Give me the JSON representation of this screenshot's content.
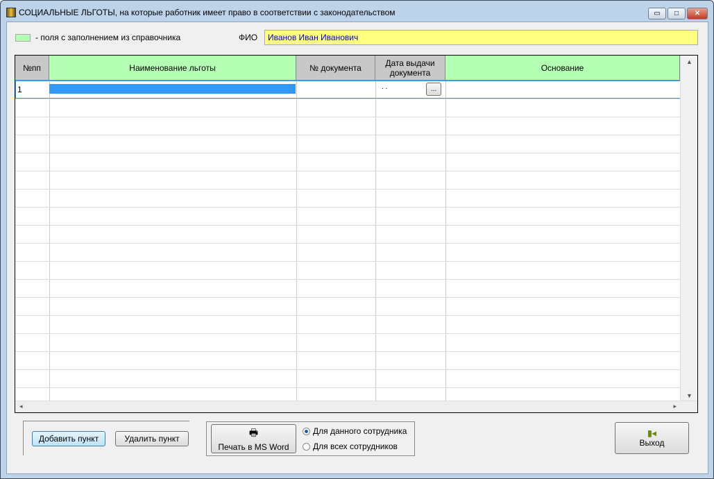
{
  "window": {
    "title": "СОЦИАЛЬНЫЕ ЛЬГОТЫ, на которые работник имеет право в соответствии с законодательством",
    "minimize": "▭",
    "maximize": "□",
    "close": "✕"
  },
  "legend": {
    "text": "- поля с заполнением из справочника",
    "color": "#b4ffb4"
  },
  "fio": {
    "label": "ФИО",
    "value": "Иванов Иван Иванович"
  },
  "table": {
    "columns": [
      "№пп",
      "Наименование льготы",
      "№ документа",
      "Дата выдачи документа",
      "Основание"
    ],
    "rows": [
      {
        "num": "1",
        "name": "",
        "doc": "",
        "date": ". .",
        "basis": ""
      }
    ],
    "date_button": "..."
  },
  "buttons": {
    "add": "Добавить пункт",
    "delete": "Удалить пункт",
    "print": "Печать в MS Word",
    "exit": "Выход"
  },
  "print_options": {
    "current": "Для данного сотрудника",
    "all": "Для всех сотрудников",
    "selected": "current"
  }
}
